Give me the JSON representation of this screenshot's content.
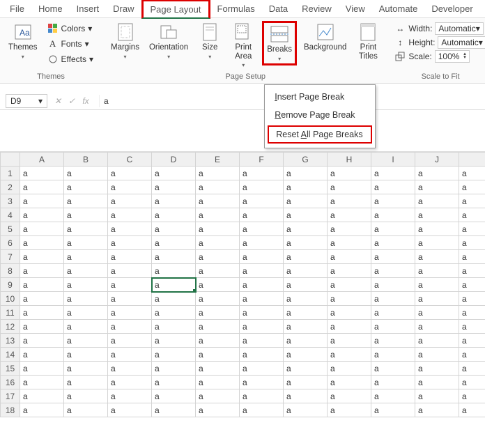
{
  "tabs": [
    "File",
    "Home",
    "Insert",
    "Draw",
    "Page Layout",
    "Formulas",
    "Data",
    "Review",
    "View",
    "Automate",
    "Developer"
  ],
  "active_tab": 4,
  "themes": {
    "label": "Themes",
    "themes_btn": "Themes",
    "colors": "Colors",
    "fonts": "Fonts",
    "effects": "Effects"
  },
  "page_setup": {
    "label": "Page Setup",
    "margins": "Margins",
    "orientation": "Orientation",
    "size": "Size",
    "print_area": "Print\nArea",
    "breaks": "Breaks",
    "background": "Background",
    "print_titles": "Print\nTitles"
  },
  "scale": {
    "label": "Scale to Fit",
    "width": "Width:",
    "height": "Height:",
    "scale": "Scale:",
    "width_val": "Automatic",
    "height_val": "Automatic",
    "scale_val": "100%"
  },
  "breaks_menu": {
    "insert": "Insert Page Break",
    "remove": "Remove Page Break",
    "reset": "Reset All Page Breaks"
  },
  "name_box": "D9",
  "formula": "a",
  "selected": {
    "row": 9,
    "col": 4
  },
  "cols": [
    "A",
    "B",
    "C",
    "D",
    "E",
    "F",
    "G",
    "H",
    "I",
    "J",
    ""
  ],
  "rows": 18,
  "cell_value": "a"
}
